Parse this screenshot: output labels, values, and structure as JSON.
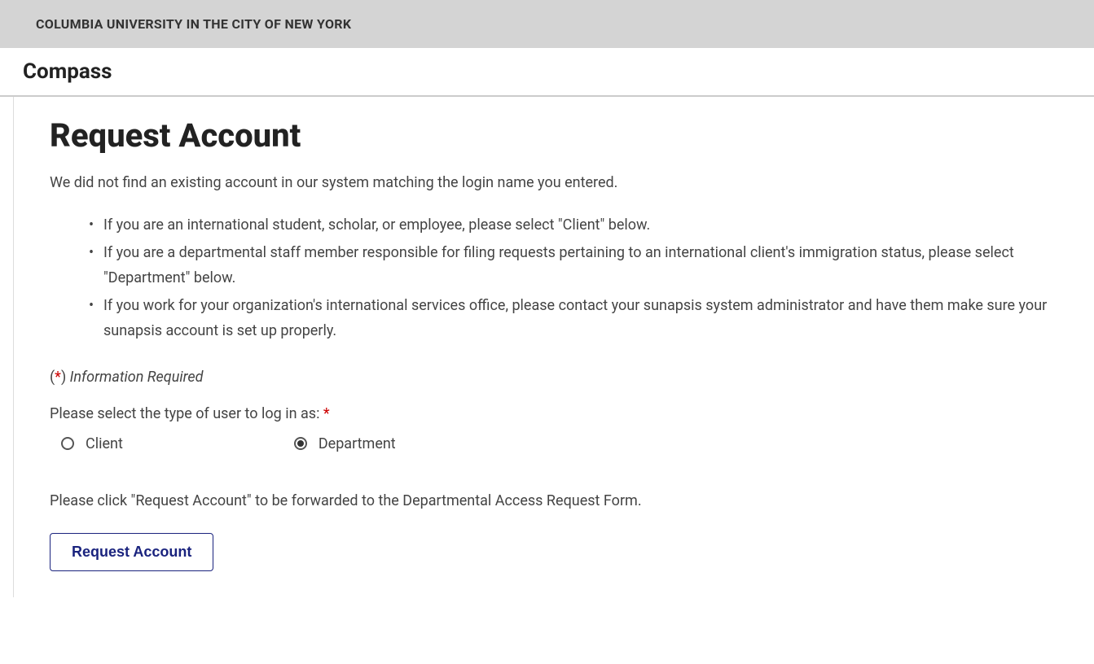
{
  "header": {
    "org_name": "COLUMBIA UNIVERSITY IN THE CITY OF NEW YORK",
    "app_name": "Compass"
  },
  "main": {
    "heading": "Request Account",
    "intro": "We did not find an existing account in our system matching the login name you entered.",
    "bullets": [
      "If you are an international student, scholar, or employee, please select \"Client\" below.",
      "If you are a departmental staff member responsible for filing requests pertaining to an international client's immigration status, please select \"Department\" below.",
      "If you work for your organization's international services office, please contact your sunapsis system administrator and have them make sure your sunapsis account is set up properly."
    ],
    "required_note": {
      "open": "(",
      "asterisk": "*",
      "close": ") ",
      "text": "Information Required"
    },
    "prompt_label": "Please select the type of user to log in as: ",
    "prompt_req": "*",
    "radio_options": [
      {
        "label": "Client",
        "selected": false
      },
      {
        "label": "Department",
        "selected": true
      }
    ],
    "forward_text": "Please click \"Request Account\" to be forwarded to the Departmental Access Request Form.",
    "button_label": "Request Account"
  }
}
